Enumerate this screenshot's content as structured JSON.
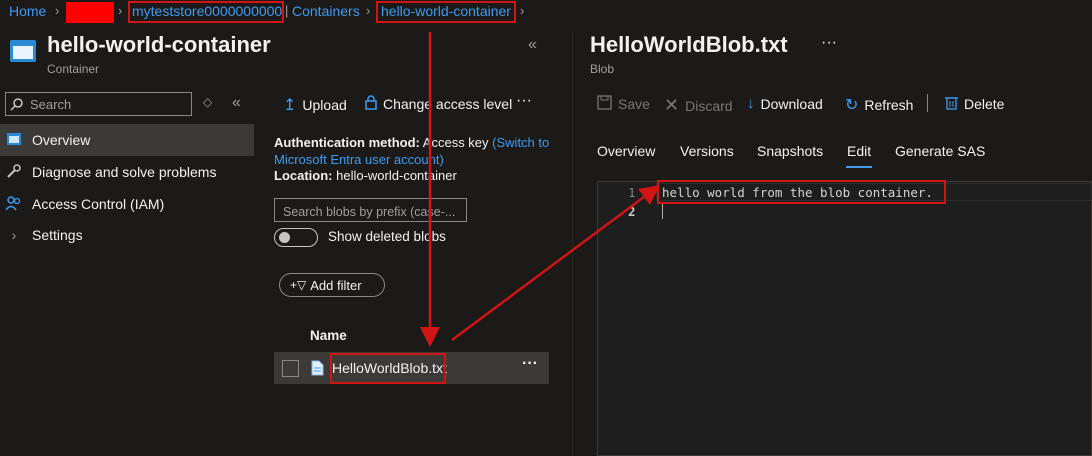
{
  "breadcrumb": {
    "home": "Home",
    "account": "myteststore0000000000",
    "containers": "Containers",
    "container": "hello-world-container"
  },
  "container": {
    "title": "hello-world-container",
    "subtitle": "Container",
    "search_placeholder": "Search",
    "nav": [
      {
        "label": "Overview",
        "icon": "storage-icon"
      },
      {
        "label": "Diagnose and solve problems",
        "icon": "wrench-icon"
      },
      {
        "label": "Access Control (IAM)",
        "icon": "people-icon"
      },
      {
        "label": "Settings",
        "icon": "chevron-right-icon"
      }
    ],
    "toolbar": {
      "upload": "Upload",
      "change_access": "Change access level",
      "more": "···"
    },
    "auth_label": "Authentication method:",
    "auth_value": "Access key",
    "auth_link": "(Switch to Microsoft Entra user account)",
    "location_label": "Location:",
    "location_value": "hello-world-container",
    "blob_search_placeholder": "Search blobs by prefix (case-...",
    "show_deleted": "Show deleted blobs",
    "add_filter": "Add filter",
    "name_header": "Name",
    "blobs": [
      {
        "name": "HelloWorldBlob.txt"
      }
    ]
  },
  "blob": {
    "title": "HelloWorldBlob.txt",
    "subtitle": "Blob",
    "more": "···",
    "toolbar": {
      "save": "Save",
      "discard": "Discard",
      "download": "Download",
      "refresh": "Refresh",
      "delete": "Delete"
    },
    "tabs": [
      "Overview",
      "Versions",
      "Snapshots",
      "Edit",
      "Generate SAS"
    ],
    "active_tab": "Edit",
    "editor_lines": [
      {
        "num": "1",
        "text": "hello world from the blob container."
      },
      {
        "num": "2",
        "text": ""
      }
    ]
  },
  "colors": {
    "accent": "#3f9bf0",
    "highlight": "#d11414",
    "background": "#1b1a19"
  }
}
